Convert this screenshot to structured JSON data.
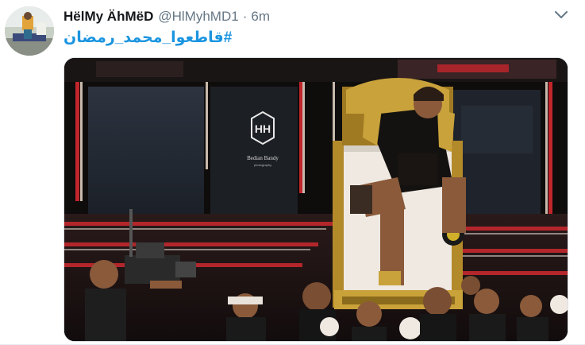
{
  "tweet": {
    "author": {
      "display_name": "HëlMy ÄhMëD",
      "handle": "@HlMyhMD1",
      "avatar_icon": "user-avatar"
    },
    "separator": "·",
    "time": "6m",
    "text": "#قاطعوا_محمد_رمضان",
    "menu_icon": "chevron-down-icon",
    "media": {
      "watermark_text": "Bedian Bandy",
      "watermark_subtext": "photography"
    }
  },
  "colors": {
    "link": "#1b95e0",
    "name": "#14171a",
    "secondary": "#657786",
    "stage_red": "#c0262b",
    "gold": "#caa23a"
  }
}
